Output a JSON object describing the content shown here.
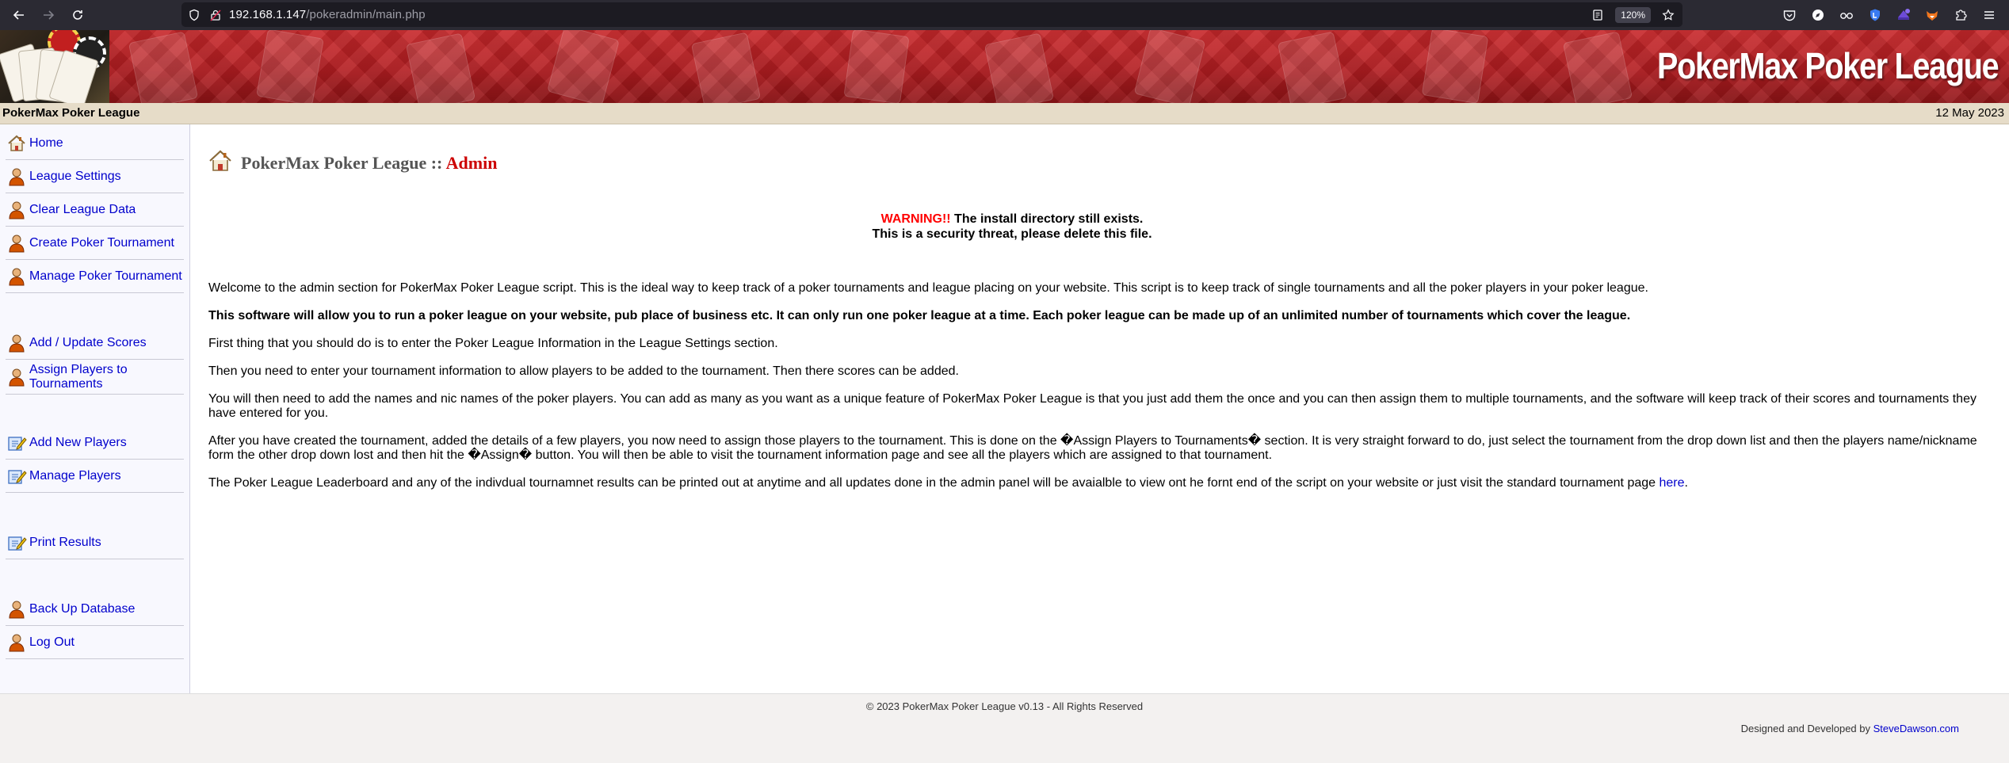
{
  "browser": {
    "url_host": "192.168.1.147",
    "url_path": "/pokeradmin/main.php",
    "zoom": "120%"
  },
  "banner": {
    "title": "PokerMax Poker League"
  },
  "info_bar": {
    "site_name": "PokerMax Poker League",
    "date": "12 May 2023"
  },
  "sidebar": {
    "items": [
      {
        "label": "Home",
        "icon": "house-icon"
      },
      {
        "label": "League Settings",
        "icon": "user-icon"
      },
      {
        "label": "Clear League Data",
        "icon": "user-icon"
      },
      {
        "label": "Create Poker Tournament",
        "icon": "user-icon"
      },
      {
        "label": "Manage Poker Tournament",
        "icon": "user-icon"
      },
      {
        "label": "Add / Update Scores",
        "icon": "user-icon"
      },
      {
        "label": "Assign Players to Tournaments",
        "icon": "user-icon"
      },
      {
        "label": "Add New Players",
        "icon": "edit-icon"
      },
      {
        "label": "Manage Players",
        "icon": "edit-icon"
      },
      {
        "label": "Print Results",
        "icon": "edit-icon"
      },
      {
        "label": "Back Up Database",
        "icon": "user-icon"
      },
      {
        "label": "Log Out",
        "icon": "user-icon"
      }
    ]
  },
  "main": {
    "title_prefix": "PokerMax Poker League :: ",
    "title_admin": "Admin",
    "warning_label": "WARNING!!",
    "warning_line1": " The install directory still exists.",
    "warning_line2": "This is a security threat, please delete this file.",
    "paragraphs": [
      "Welcome to the admin section for PokerMax Poker League script. This is the ideal way to keep track of a poker tournaments and league placing on your website. This script is to keep track of single tournaments and all the poker players in your poker league.",
      "This software will allow you to run a poker league on your website, pub place of business etc. It can only run one poker league at a time. Each poker league can be made up of an unlimited number of tournaments which cover the league.",
      "First thing that you should do is to enter the Poker League Information in the League Settings section.",
      "Then you need to enter your tournament information to allow players to be added to the tournament. Then there scores can be added.",
      "You will then need to add the names and nic names of the poker players. You can add as many as you want as a unique feature of PokerMax Poker League is that you just add them the once and you can then assign them to multiple tournaments, and the software will keep track of their scores and tournaments they have entered for you.",
      "After you have created the tournament, added the details of a few players, you now need to assign those players to the tournament. This is done on the �Assign Players to Tournaments� section. It is very straight forward to do, just select the tournament from the drop down list and then the players name/nickname form the other drop down lost and then hit the �Assign� button. You will then be able to visit the tournament information page and see all the players which are assigned to that tournament."
    ],
    "last_paragraph_text": "The Poker League Leaderboard and any of the indivdual tournamnet results can be printed out at anytime and all updates done in the admin panel will be avaialble to view ont he fornt end of the script on your website or just visit the standard tournament page ",
    "last_paragraph_link": "here",
    "last_paragraph_end": "."
  },
  "footer": {
    "copyright": "© 2023 PokerMax Poker League v0.13 - All Rights Reserved",
    "credit_prefix": "Designed and Developed by ",
    "credit_link": "SteveDawson.com"
  },
  "colors": {
    "link": "#0000cc",
    "warning": "#ff0000",
    "admin": "#cc0000",
    "banner": "#b31d21",
    "info_bar": "#e6dcc8"
  }
}
